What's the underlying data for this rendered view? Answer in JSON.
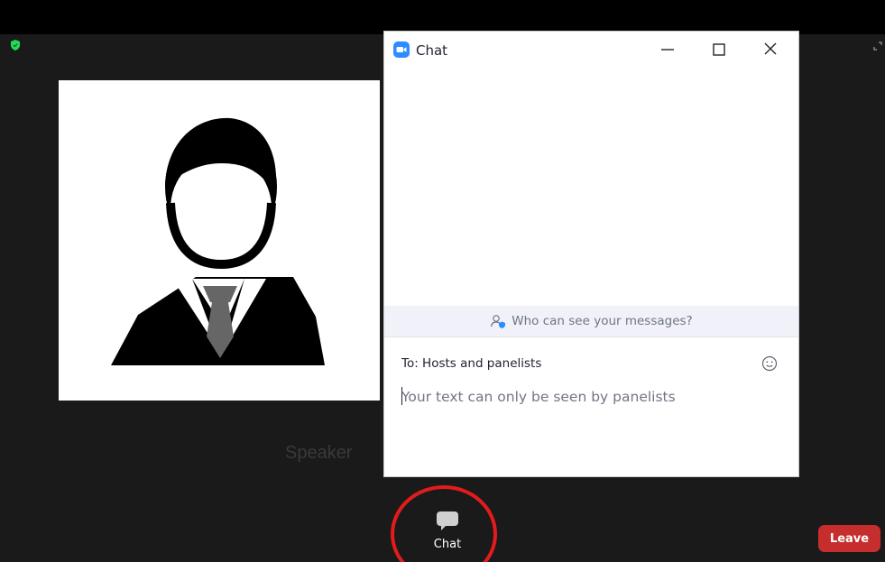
{
  "meeting": {
    "speaker_name": "Speaker"
  },
  "chat_window": {
    "title": "Chat",
    "notice": "Who can see your messages?",
    "to_label": "To:  Hosts and panelists",
    "input_placeholder": "Your text can only be seen by panelists",
    "input_value": ""
  },
  "toolbar": {
    "chat_label": "Chat",
    "leave_label": "Leave"
  },
  "icons": {
    "shield": "shield-icon",
    "fullscreen": "fullscreen-icon",
    "chat_logo": "zoom-logo-icon",
    "minimize": "minimize-icon",
    "maximize": "maximize-icon",
    "close": "close-icon",
    "notice": "user-visibility-icon",
    "emoji": "emoji-icon",
    "chat_bubble": "chat-bubble-icon"
  },
  "colors": {
    "leave": "#c62e2e",
    "highlight": "#e31b1b",
    "zoom_blue": "#2d8cff",
    "security_green": "#23d959"
  }
}
